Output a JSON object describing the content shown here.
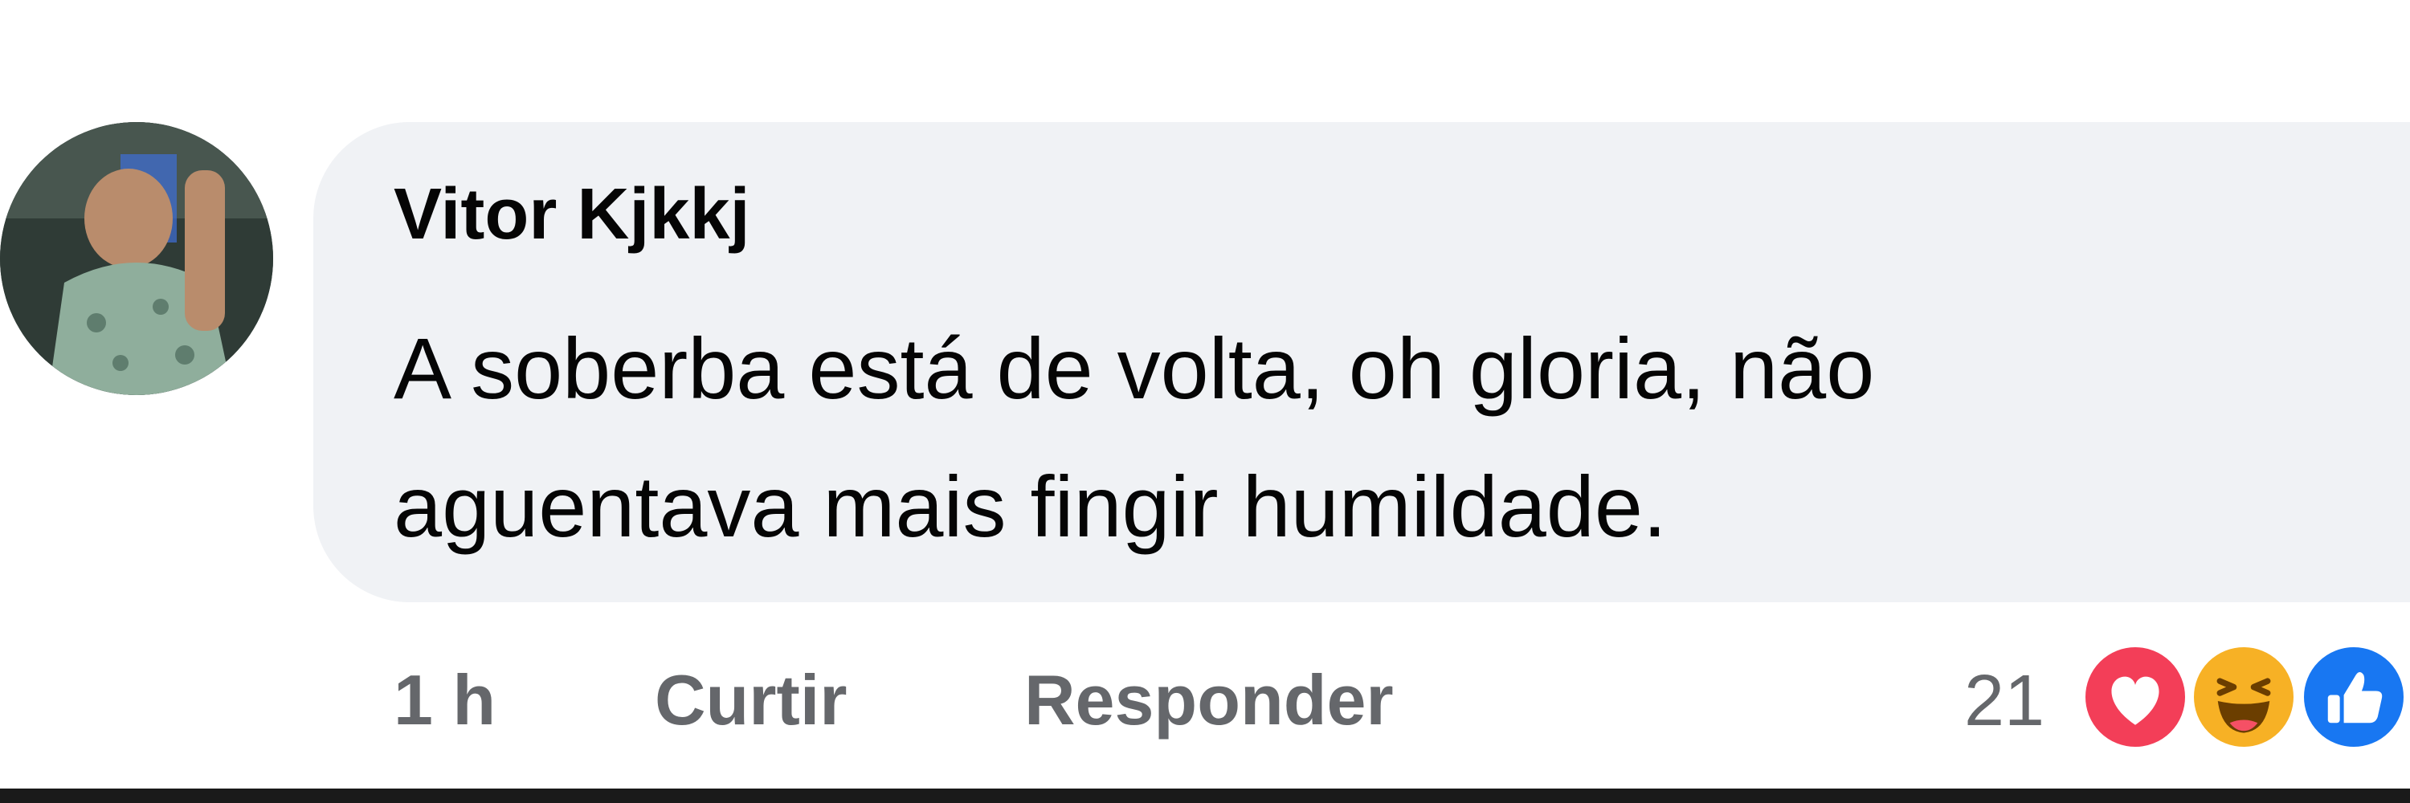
{
  "comment": {
    "author": "Vitor Kjkkj",
    "text_lines": [
      "A soberba está de volta, oh gloria, não",
      "aguentava mais fingir humildade."
    ]
  },
  "actions": {
    "time": "1 h",
    "like_label": "Curtir",
    "reply_label": "Responder"
  },
  "reactions": {
    "count": "21",
    "types": [
      "love-icon",
      "haha-icon",
      "like-icon"
    ]
  },
  "colors": {
    "bubble_bg": "#f0f2f5",
    "text": "#050505",
    "meta_text": "#65676b",
    "love": "#f33e58",
    "haha": "#f7b125",
    "like": "#1877f2"
  }
}
